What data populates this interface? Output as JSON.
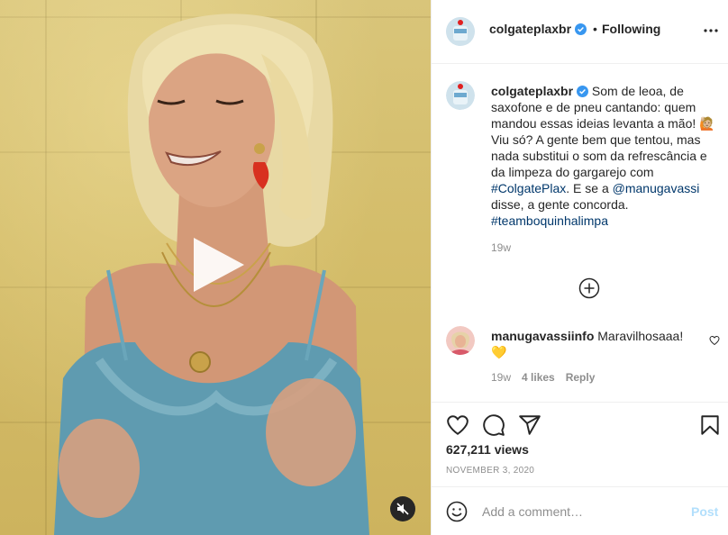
{
  "post": {
    "author": "colgateplaxbr",
    "follow_separator": "•",
    "follow_status": "Following",
    "caption_text": " Som de leoa, de saxofone e de pneu cantando: quem mandou essas ideias levanta a mão! 🙋🏼 Viu só? A gente bem que tentou, mas nada substitui o som da refrescância e da limpeza do gargarejo com ",
    "hashtag_1": "#ColgatePlax",
    "caption_mid": ". E se a ",
    "mention": "@manugavassi",
    "caption_end": " disse, a gente concorda. ",
    "hashtag_2": "#teamboquinhalimpa",
    "caption_time": "19w"
  },
  "comments": [
    {
      "user": "manugavassiinfo",
      "text": " Maravilhosaaa! 💛",
      "time": "19w",
      "likes": "4 likes",
      "reply": "Reply"
    }
  ],
  "stats": {
    "views": "627,211 views",
    "date": "NOVEMBER 3, 2020"
  },
  "composer": {
    "placeholder": "Add a comment…",
    "post_label": "Post"
  },
  "icons": {
    "verified": "verified-badge-icon",
    "more": "more-options-icon",
    "load_more": "load-more-comments-icon",
    "like": "heart-icon",
    "comment": "comment-icon",
    "share": "share-icon",
    "save": "bookmark-icon",
    "emoji": "emoji-icon",
    "play": "play-icon",
    "mute": "muted-speaker-icon"
  },
  "colors": {
    "link": "#00376b",
    "verified": "#3897f0",
    "post_disabled": "#b2dffc",
    "muted_text": "#8e8e8e"
  }
}
